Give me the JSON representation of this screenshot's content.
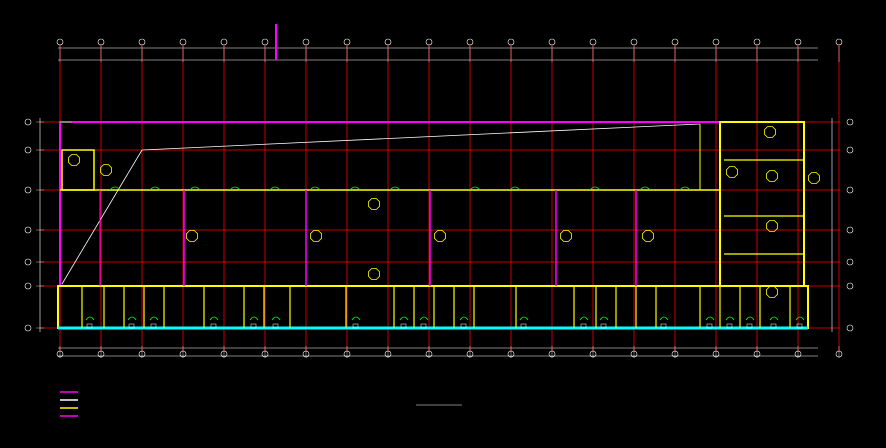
{
  "drawing": {
    "title": "",
    "scale_label": "",
    "legend_heading": "",
    "legend_items": [
      {
        "label": "",
        "color": "#ff00ff"
      },
      {
        "label": "",
        "color": "#ffffff"
      },
      {
        "label": "",
        "color": "#ffff00"
      },
      {
        "label": "",
        "color": "#ff00ff"
      }
    ],
    "notes": [
      "",
      ""
    ],
    "colors": {
      "background": "#000000",
      "grid": "#ff0000",
      "wall_primary": "#ff00ff",
      "wall_secondary": "#ffff00",
      "dimension": "#ffffff",
      "annotation": "#00ff00",
      "water": "#00ffff"
    },
    "room_tags": [
      "",
      "",
      "",
      "",
      "",
      "",
      "",
      "",
      "",
      "",
      "",
      "",
      ""
    ],
    "grid_bubbles_top": [
      "",
      "",
      "",
      "",
      "",
      "",
      "",
      "",
      "",
      "",
      "",
      "",
      "",
      "",
      "",
      "",
      "",
      "",
      "",
      ""
    ],
    "grid_bubbles_side": [
      "",
      "",
      "",
      "",
      "",
      "",
      ""
    ]
  }
}
